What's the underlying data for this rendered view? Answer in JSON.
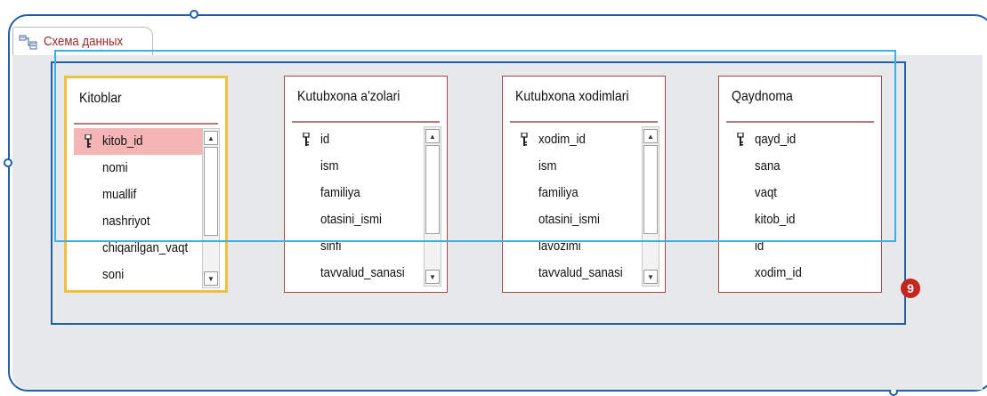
{
  "tab": {
    "label": "Схема данных",
    "icon": "relationships-icon"
  },
  "tables": [
    {
      "title": "Kitoblar",
      "fields": [
        {
          "name": "kitob_id",
          "key": true
        },
        {
          "name": "nomi"
        },
        {
          "name": "muallif"
        },
        {
          "name": "nashriyot"
        },
        {
          "name": "chiqarilgan_vaqt"
        },
        {
          "name": "soni"
        }
      ]
    },
    {
      "title": "Kutubxona a'zolari",
      "fields": [
        {
          "name": "id",
          "key": true
        },
        {
          "name": "ism"
        },
        {
          "name": "familiya"
        },
        {
          "name": "otasini_ismi"
        },
        {
          "name": "sinfi"
        },
        {
          "name": "tavvalud_sanasi"
        }
      ]
    },
    {
      "title": "Kutubxona xodimlari",
      "fields": [
        {
          "name": "xodim_id",
          "key": true
        },
        {
          "name": "ism"
        },
        {
          "name": "familiya"
        },
        {
          "name": "otasini_ismi"
        },
        {
          "name": "lavozimi"
        },
        {
          "name": "tavvalud_sanasi"
        }
      ]
    },
    {
      "title": "Qaydnoma",
      "fields": [
        {
          "name": "qayd_id",
          "key": true
        },
        {
          "name": "sana"
        },
        {
          "name": "vaqt"
        },
        {
          "name": "kitob_id"
        },
        {
          "name": "id"
        },
        {
          "name": "xodim_id"
        }
      ]
    }
  ],
  "callout": {
    "number": "9"
  },
  "colors": {
    "frame": "#1f5fa8",
    "callout_light": "#3ab0e8",
    "badge": "#c4261d",
    "selected_border": "#f0c040",
    "key_highlight": "#f5b5b5",
    "tab_text": "#9b2a2a"
  }
}
